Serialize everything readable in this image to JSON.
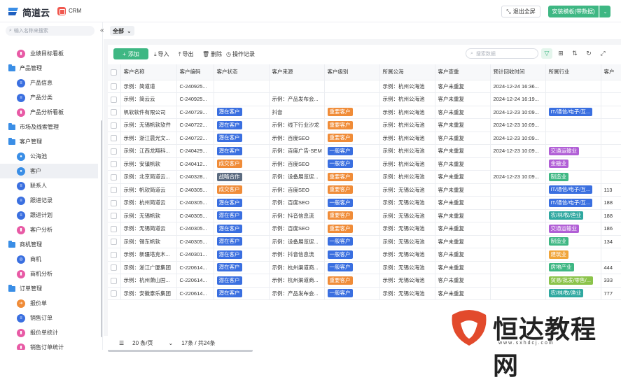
{
  "app": {
    "brand": "简道云",
    "module": "CRM",
    "exit_label": "退出全屏",
    "install_label": "安装模板(带数据)"
  },
  "sidebar": {
    "search_placeholder": "输入名称来搜索",
    "items": [
      {
        "label": "业绩目标看板",
        "type": "child",
        "icon": "chart-icon",
        "color": "#e85aa5"
      },
      {
        "label": "产品管理",
        "type": "group",
        "icon": "folder-icon"
      },
      {
        "label": "产品信息",
        "type": "child",
        "icon": "document-icon",
        "color": "#3a6fe0"
      },
      {
        "label": "产品分类",
        "type": "child",
        "icon": "document-icon",
        "color": "#3a6fe0"
      },
      {
        "label": "产品分析看板",
        "type": "child",
        "icon": "chart-icon",
        "color": "#e85aa5"
      },
      {
        "label": "市场及线索管理",
        "type": "group",
        "icon": "folder-icon"
      },
      {
        "label": "客户管理",
        "type": "group",
        "icon": "folder-icon"
      },
      {
        "label": "公海池",
        "type": "child",
        "icon": "user-icon",
        "color": "#3a8ee6"
      },
      {
        "label": "客户",
        "type": "child",
        "icon": "user-icon",
        "color": "#3a8ee6",
        "active": true
      },
      {
        "label": "联系人",
        "type": "child",
        "icon": "document-icon",
        "color": "#3a6fe0"
      },
      {
        "label": "跟进记录",
        "type": "child",
        "icon": "document-icon",
        "color": "#3a6fe0"
      },
      {
        "label": "跟进计划",
        "type": "child",
        "icon": "document-icon",
        "color": "#3a6fe0"
      },
      {
        "label": "客户分析",
        "type": "child",
        "icon": "chart-icon",
        "color": "#e85aa5"
      },
      {
        "label": "商机管理",
        "type": "group",
        "icon": "folder-icon"
      },
      {
        "label": "商机",
        "type": "child",
        "icon": "target-icon",
        "color": "#3a6fe0"
      },
      {
        "label": "商机分析",
        "type": "child",
        "icon": "chart-icon",
        "color": "#e85aa5"
      },
      {
        "label": "订单管理",
        "type": "group",
        "icon": "folder-icon"
      },
      {
        "label": "报价单",
        "type": "child",
        "icon": "arrow-icon",
        "color": "#f08c38"
      },
      {
        "label": "销售订单",
        "type": "child",
        "icon": "document-icon",
        "color": "#3a6fe0"
      },
      {
        "label": "报价单统计",
        "type": "child",
        "icon": "chart-icon",
        "color": "#e85aa5"
      },
      {
        "label": "销售订单统计",
        "type": "child",
        "icon": "chart-icon",
        "color": "#e85aa5"
      }
    ]
  },
  "filter": {
    "scope": "全部"
  },
  "toolbar": {
    "add": "添加",
    "import": "导入",
    "export": "导出",
    "delete": "删除",
    "log": "操作记录",
    "search_placeholder": "搜索数据"
  },
  "table": {
    "headers": [
      "客户名称",
      "客户编码",
      "客户状态",
      "客户来源",
      "客户级别",
      "所属公海",
      "客户查重",
      "预计回收时间",
      "所属行业",
      "客户"
    ],
    "rows": [
      [
        "示例：简道道",
        "C-240925...",
        "",
        "",
        "",
        "示例：杭州公海池",
        "客户未重复",
        "2024-12-24 16:36...",
        "",
        ""
      ],
      [
        "示例：简云云",
        "C-240925...",
        "",
        "示例：产品发布会...",
        "",
        "示例：杭州公海池",
        "客户未重复",
        "2024-12-24 16:19...",
        "",
        ""
      ],
      [
        "帆软软件有限公司",
        "C-240729...",
        "潜在客户",
        "抖音",
        "重要客户",
        "示例：杭州公海池",
        "客户未重复",
        "2024-12-23 10:09...",
        "IT/通信/电子/互...",
        ""
      ],
      [
        "示例：无锡帆软软件",
        "C-240722...",
        "潜在客户",
        "示例：线下行业沙龙",
        "重要客户",
        "示例：杭州公海池",
        "客户未重复",
        "2024-12-23 10:09...",
        "",
        ""
      ],
      [
        "示例：浙江晨光文...",
        "C-240722...",
        "潜在客户",
        "示例：百度SEO",
        "重要客户",
        "示例：杭州公海池",
        "客户未重复",
        "2024-12-23 10:09...",
        "",
        ""
      ],
      [
        "示例：江西龙翔科...",
        "C-240429...",
        "潜在客户",
        "示例：百度广告-SEM",
        "一般客户",
        "示例：杭州公海池",
        "客户未重复",
        "2024-12-23 10:09...",
        "交通运输业",
        ""
      ],
      [
        "示例：安镇帆软",
        "C-240412...",
        "成交客户",
        "示例：百度SEO",
        "一般客户",
        "示例：杭州公海池",
        "客户未重复",
        "",
        "金融业",
        ""
      ],
      [
        "示例：北京简道云...",
        "C-240328...",
        "战略合作",
        "示例：设备展览促...",
        "重要客户",
        "示例：杭州公海池",
        "客户未重复",
        "2024-12-23 10:09...",
        "制造业",
        ""
      ],
      [
        "示例：帆软简道云",
        "C-240305...",
        "成交客户",
        "示例：百度SEO",
        "重要客户",
        "示例：无锡公海池",
        "客户未重复",
        "",
        "IT/通信/电子/互...",
        "113"
      ],
      [
        "示例：杭州简道云",
        "C-240305...",
        "潜在客户",
        "示例：百度SEO",
        "一般客户",
        "示例：无锡公海池",
        "客户未重复",
        "",
        "IT/通信/电子/互...",
        "188"
      ],
      [
        "示例：无锡帆软",
        "C-240305...",
        "潜在客户",
        "示例：抖音信息流",
        "重要客户",
        "示例：无锡公海池",
        "客户未重复",
        "",
        "农/林/牧/渔业",
        "188"
      ],
      [
        "示例：无锡简道云",
        "C-240305...",
        "潜在客户",
        "示例：百度SEO",
        "重要客户",
        "示例：无锡公海池",
        "客户未重复",
        "",
        "交通运输业",
        "186"
      ],
      [
        "示例：锡东帆软",
        "C-240305...",
        "潜在客户",
        "示例：设备展览促...",
        "一般客户",
        "示例：无锡公海池",
        "客户未重复",
        "",
        "制造业",
        "134"
      ],
      [
        "示例：新疆塔克木...",
        "C-240301...",
        "潜在客户",
        "示例：抖音信息流",
        "一般客户",
        "示例：无锡公海池",
        "客户未重复",
        "",
        "建筑业",
        ""
      ],
      [
        "示例：浙江广厦集团",
        "C-220614...",
        "潜在客户",
        "示例：杭州渠道商...",
        "一般客户",
        "示例：无锡公海池",
        "客户未重复",
        "",
        "房地产业",
        "444"
      ],
      [
        "示例：杭州萧山国...",
        "C-220614...",
        "潜在客户",
        "示例：杭州渠道商...",
        "重要客户",
        "示例：无锡公海池",
        "客户未重复",
        "",
        "贸易/批发/零售/...",
        "333"
      ],
      [
        "示例：安徽泰乐集团",
        "C-220614...",
        "潜在客户",
        "示例：产品发布会...",
        "一般客户",
        "示例：无锡公海池",
        "客户未重复",
        "",
        "农/林/牧/渔业",
        "777"
      ]
    ]
  },
  "tag_colors": {
    "潜在客户": "#3a6fe0",
    "成交客户": "#f08c38",
    "战略合作": "#5b6b80",
    "重要客户": "#f08c38",
    "一般客户": "#3a6fe0",
    "IT/通信/电子/互...": "#3a6fe0",
    "交通运输业": "#b15fd6",
    "金融业": "#b15fd6",
    "制造业": "#3eb783",
    "农/林/牧/渔业": "#2fa8a0",
    "建筑业": "#f0a53a",
    "房地产业": "#3eb783",
    "贸易/批发/零售/...": "#8bc34a"
  },
  "pager": {
    "page_size": "20 条/页",
    "summary": "17条 / 共24条"
  },
  "watermark": {
    "text": "恒达教程网",
    "url": "www.sxhdcj.com"
  }
}
